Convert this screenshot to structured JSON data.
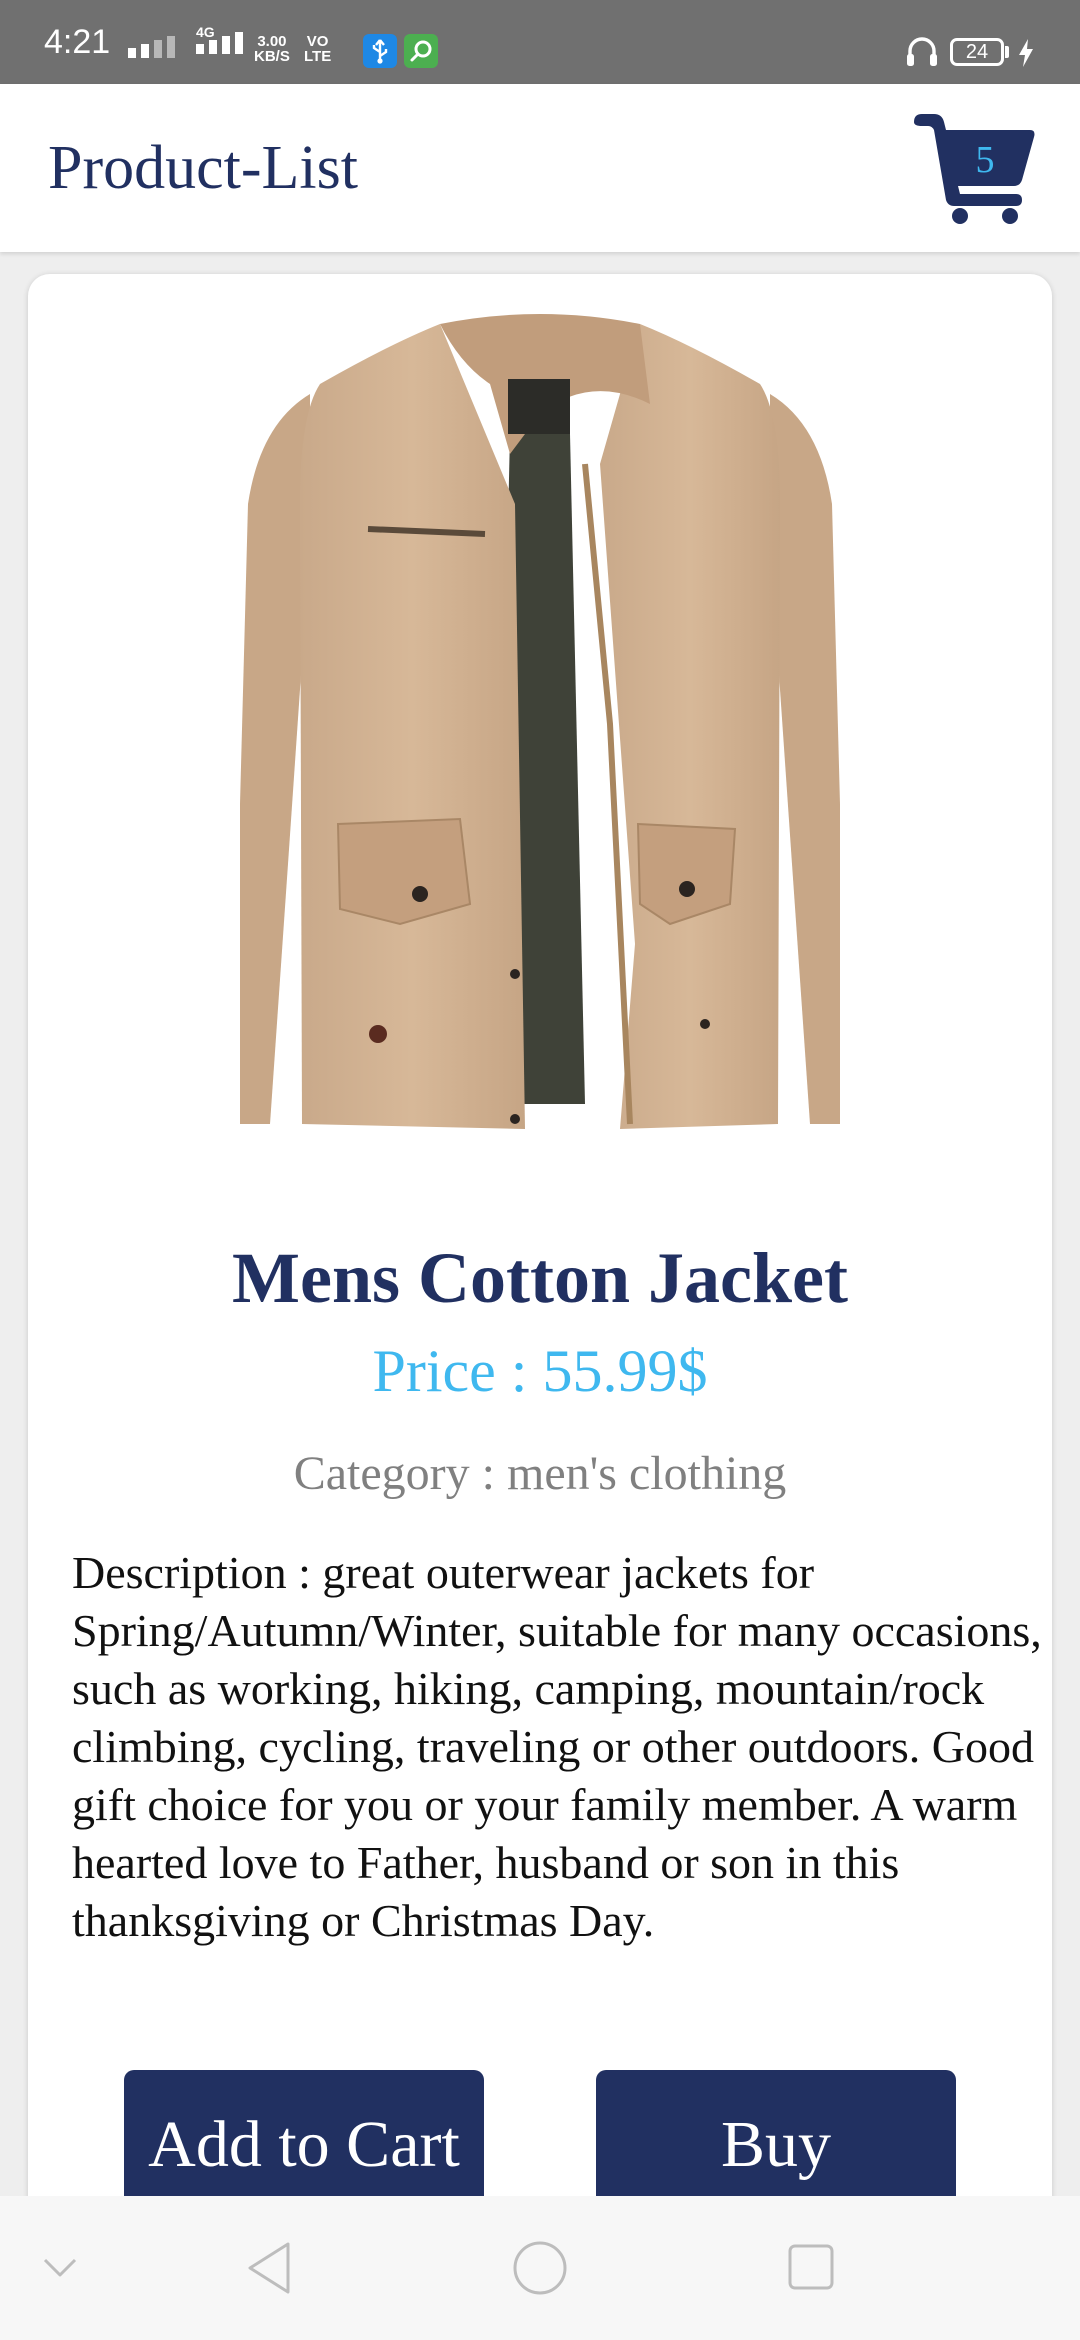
{
  "status_bar": {
    "time": "4:21",
    "network_type": "4G",
    "speed_value": "3.00",
    "speed_unit": "KB/S",
    "volte_top": "VO",
    "volte_bottom": "LTE",
    "battery_level": "24"
  },
  "app_bar": {
    "title": "Product-List",
    "cart_count": "5"
  },
  "product": {
    "title": "Mens Cotton Jacket",
    "price": "Price : 55.99$",
    "category": "Category : men's clothing",
    "description": "Description : great outerwear jackets for Spring/Autumn/Winter, suitable for many occasions, such as working, hiking, camping, mountain/rock climbing, cycling, traveling or other outdoors. Good gift choice for you or your family member. A warm hearted love to Father, husband or son in this thanksgiving or Christmas Day.",
    "add_to_cart_label": "Add to Cart",
    "buy_label": "Buy"
  },
  "icons": {
    "cart": "shopping-cart-icon",
    "back": "triangle-back-icon",
    "home": "circle-home-icon",
    "recents": "square-recents-icon",
    "collapse": "chevron-down-icon"
  },
  "colors": {
    "primary": "#213061",
    "accent": "#3fb8ef",
    "status_bar": "#707070",
    "category_text": "#808080"
  }
}
